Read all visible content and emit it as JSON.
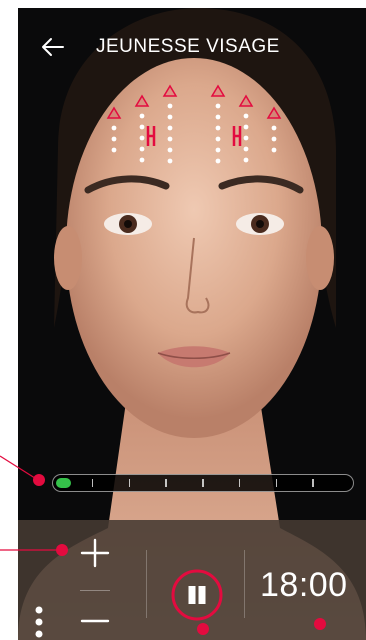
{
  "header": {
    "title": "JEUNESSE VISAGE"
  },
  "progress": {
    "value": 0.05,
    "segments": 8
  },
  "controls": {
    "timer": "18:00"
  },
  "icons": {
    "back": "arrow-left-icon",
    "plus": "plus-icon",
    "minus": "minus-icon",
    "pause": "pause-icon",
    "more": "more-vertical-icon"
  },
  "colors": {
    "accent": "#e30b3f",
    "progress_active": "#35c24a",
    "panel_bg": "#463a32",
    "text": "#ffffff"
  }
}
